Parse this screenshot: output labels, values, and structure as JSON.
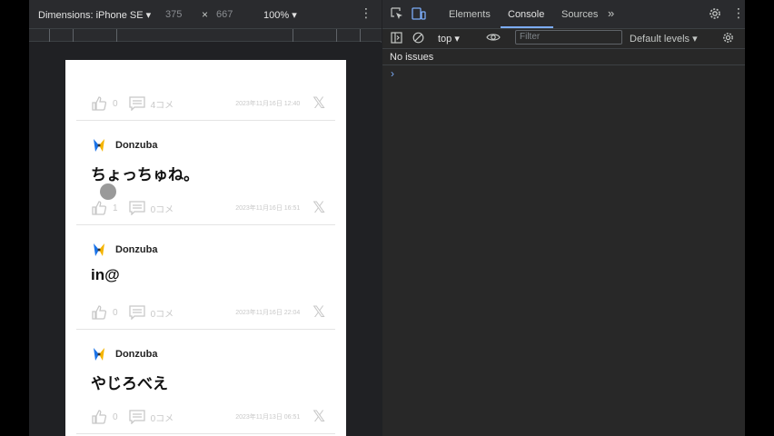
{
  "device_toolbar": {
    "dimensions_label": "Dimensions: iPhone SE",
    "width": "375",
    "times": "×",
    "height": "667",
    "zoom": "100%"
  },
  "posts": [
    {
      "author": "",
      "text": "",
      "likes": "0",
      "comments": "4コメ",
      "date": "2023年11月16日 12:40"
    },
    {
      "author": "Donzuba",
      "text": "ちょっちゅね。",
      "likes": "1",
      "comments": "0コメ",
      "date": "2023年11月16日 16:51"
    },
    {
      "author": "Donzuba",
      "text": "in@",
      "likes": "0",
      "comments": "0コメ",
      "date": "2023年11月16日 22:04"
    },
    {
      "author": "Donzuba",
      "text": "やじろべえ",
      "likes": "0",
      "comments": "0コメ",
      "date": "2023年11月13日 06:51"
    }
  ],
  "devtools": {
    "tabs": [
      "Elements",
      "Console",
      "Sources"
    ],
    "active_tab": "Console",
    "context": "top",
    "filter_placeholder": "Filter",
    "levels": "Default levels",
    "issues": "No issues"
  },
  "colors": {
    "panel_bg": "#202124",
    "accent": "#7cacf8"
  }
}
